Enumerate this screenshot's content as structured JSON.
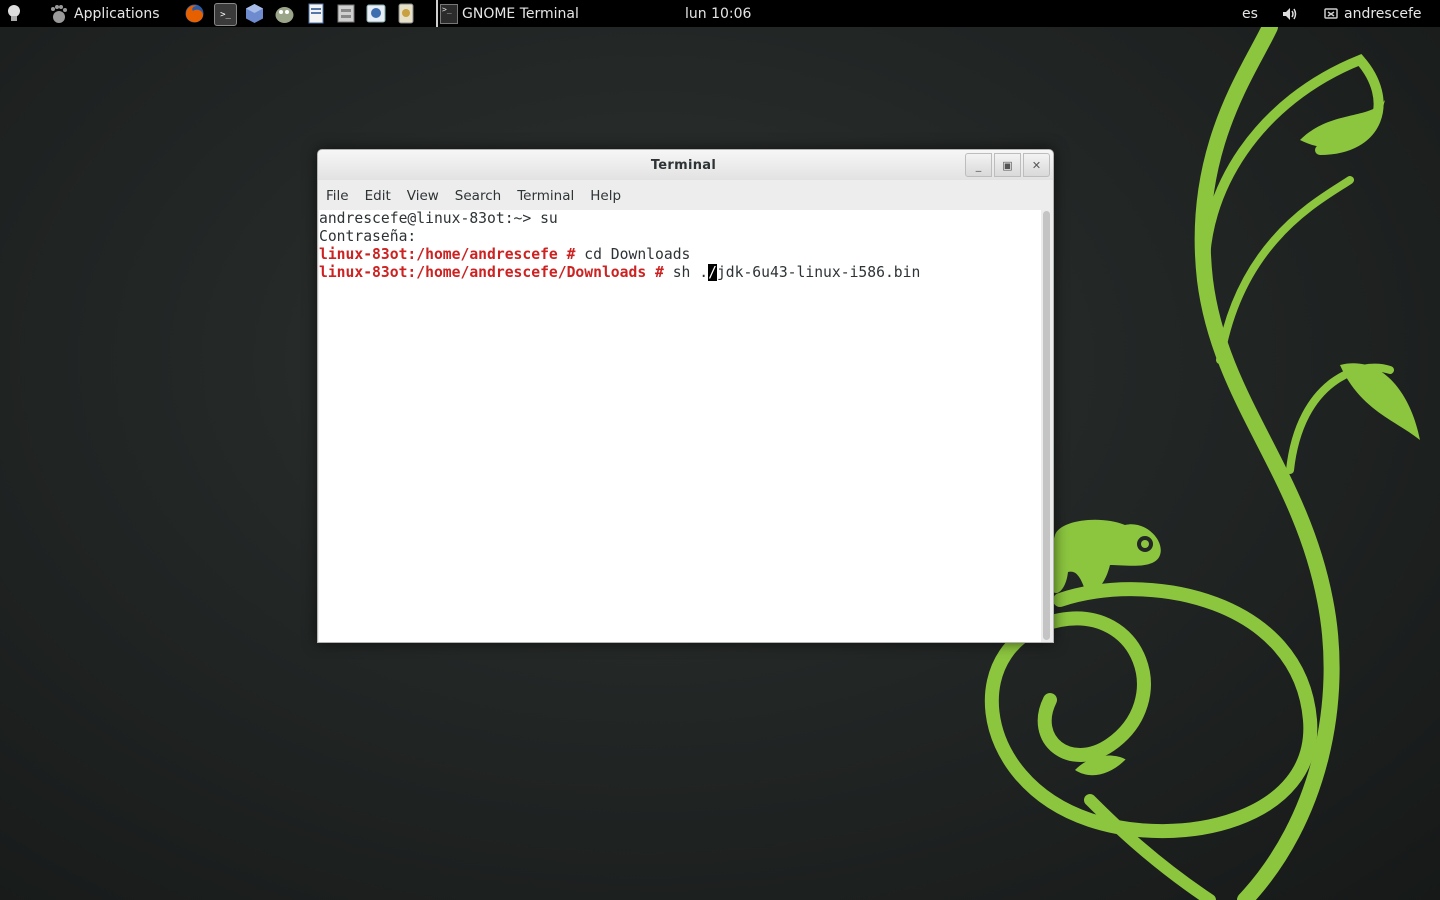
{
  "top_panel": {
    "applications_label": "Applications",
    "task_title": "GNOME Terminal",
    "clock": "lun 10:06",
    "keyboard_layout": "es",
    "user_name": "andrescefe",
    "launchers": [
      "firefox-icon",
      "terminal-icon",
      "virtualbox-icon",
      "gimp-icon",
      "document-icon",
      "file-manager-icon",
      "chat-icon",
      "settings-icon"
    ]
  },
  "window": {
    "title": "Terminal",
    "menu": [
      "File",
      "Edit",
      "View",
      "Search",
      "Terminal",
      "Help"
    ]
  },
  "terminal": {
    "line1": "andrescefe@linux-83ot:~> su",
    "line2": "Contraseña:",
    "line3_prompt": "linux-83ot:/home/andrescefe #",
    "line3_cmd": " cd Downloads",
    "line4_prompt": "linux-83ot:/home/andrescefe/Downloads #",
    "line4_cmd_before": " sh .",
    "line4_cursor_char": "/",
    "line4_cmd_after": "jdk-6u43-linux-i586.bin"
  },
  "colors": {
    "wallpaper_green": "#8cc63f",
    "root_prompt": "#cc2222"
  }
}
